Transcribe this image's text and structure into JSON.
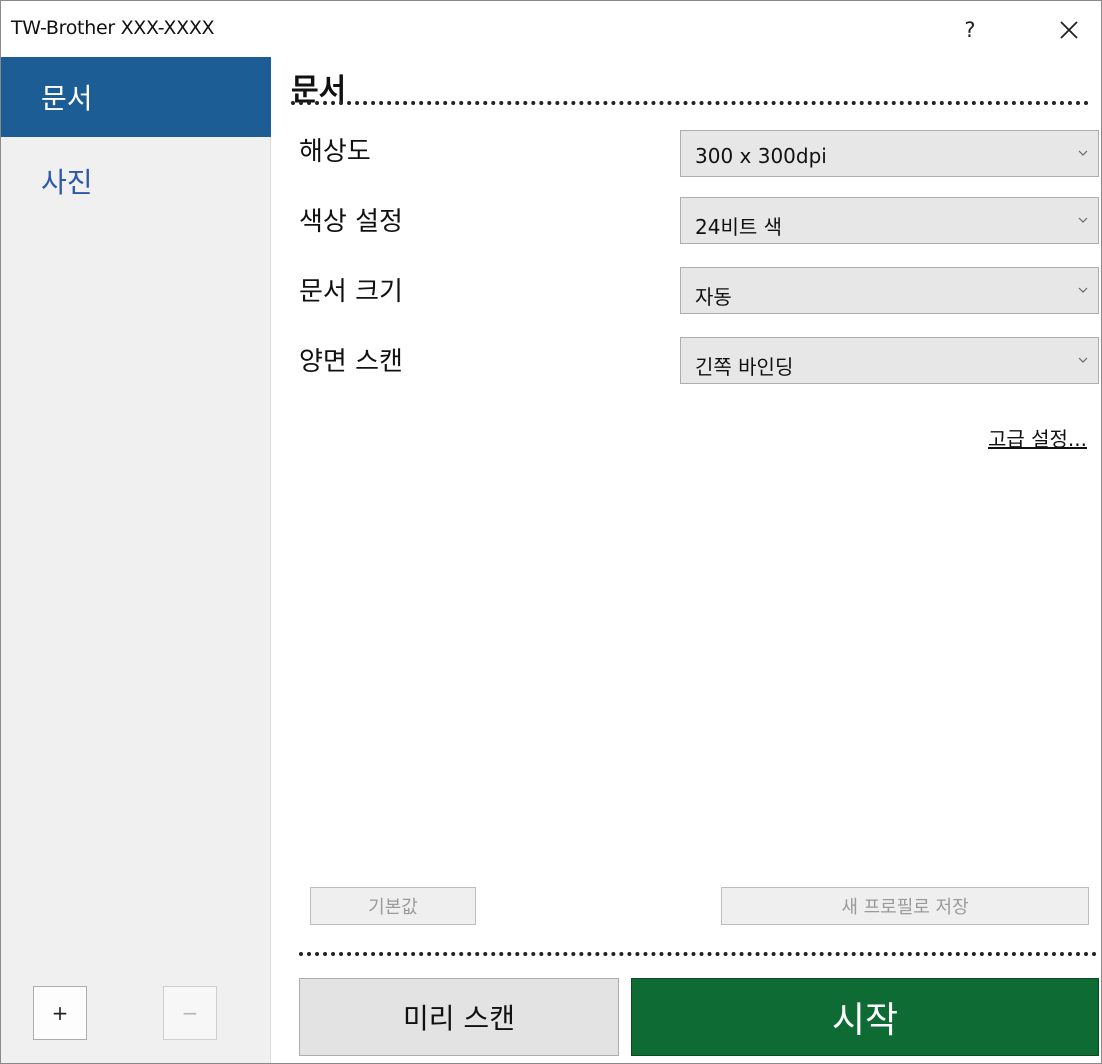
{
  "window": {
    "title": "TW-Brother XXX-XXXX",
    "help_label": "?"
  },
  "sidebar": {
    "items": [
      {
        "label": "문서",
        "selected": true
      },
      {
        "label": "사진",
        "selected": false
      }
    ],
    "add_label": "+",
    "remove_label": "−"
  },
  "main": {
    "title": "문서",
    "settings": [
      {
        "label": "해상도",
        "value": "300 x 300dpi"
      },
      {
        "label": "색상 설정",
        "value": "24비트 색"
      },
      {
        "label": "문서 크기",
        "value": "자동"
      },
      {
        "label": "양면 스캔",
        "value": "긴쪽 바인딩"
      }
    ],
    "advanced_link": "고급 설정...",
    "default_button": "기본값",
    "save_profile_button": "새 프로필로 저장",
    "preview_button": "미리 스캔",
    "start_button": "시작"
  },
  "colors": {
    "accent": "#1d5d96",
    "start": "#0e6b33",
    "sidebar_link": "#2d57a8"
  },
  "icons": {
    "close": "close-icon",
    "dropdown": "chevron-down-icon"
  }
}
